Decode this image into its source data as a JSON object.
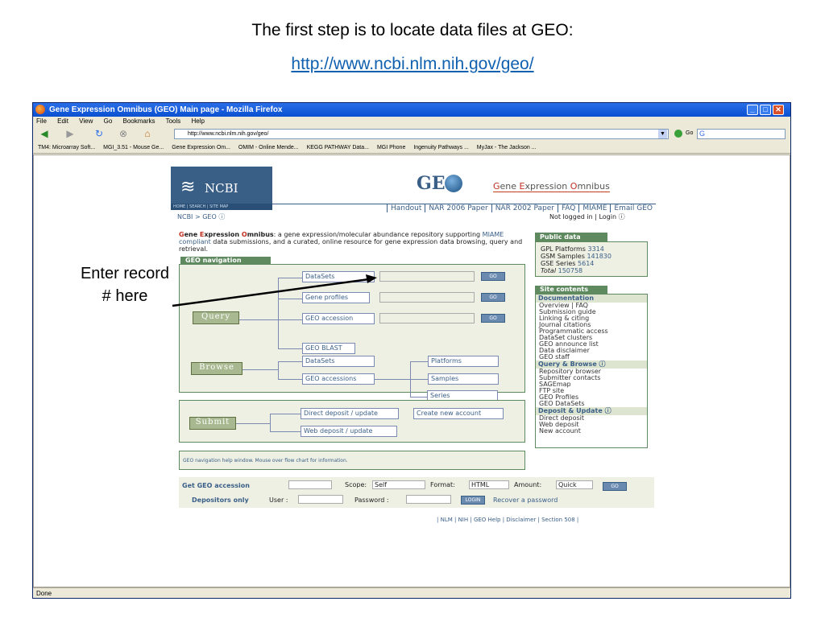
{
  "slide": {
    "title": "The first step is to locate data files at GEO:",
    "url": "http://www.ncbi.nlm.nih.gov/geo/",
    "annotation": "Enter record # here"
  },
  "browser": {
    "title": "Gene Expression Omnibus (GEO) Main page - Mozilla Firefox",
    "menu": [
      "File",
      "Edit",
      "View",
      "Go",
      "Bookmarks",
      "Tools",
      "Help"
    ],
    "address": "http://www.ncbi.nlm.nih.gov/geo/",
    "go_label": "Go",
    "bookmarks": [
      "TM4: Microarray Soft...",
      "MGI_3.51 - Mouse Ge...",
      "Gene Expression Om...",
      "OMIM - Online Mende...",
      "KEGG PATHWAY Data...",
      "MGI Phone",
      "Ingenuity Pathways ...",
      "MyJax - The Jackson ..."
    ],
    "status": "Done"
  },
  "geo": {
    "ncbi": "NCBI",
    "home_links": "HOME | SEARCH | SITE MAP",
    "geo_logo": "GE",
    "subtitle_parts": [
      "G",
      "ene ",
      "E",
      "xpression ",
      "O",
      "mnibus"
    ],
    "nav_links": [
      "Handout",
      "NAR 2006 Paper",
      "NAR 2002 Paper",
      "FAQ",
      "MIAME",
      "Email GEO"
    ],
    "breadcrumb": "NCBI > GEO",
    "login_status": "Not logged in | Login",
    "intro_bold": [
      "G",
      "ene ",
      "E",
      "xpression ",
      "O",
      "mnibus"
    ],
    "intro_rest": ": a gene expression/molecular abundance repository supporting",
    "intro_link": "MIAME compliant",
    "intro_end": "data submissions, and a curated, online resource for gene expression data browsing, query and retrieval.",
    "nav_tab": "GEO navigation",
    "query": "Query",
    "browse": "Browse",
    "submit": "Submit",
    "query_items": [
      "DataSets",
      "Gene profiles",
      "GEO accession",
      "GEO BLAST"
    ],
    "browse_items": [
      "DataSets",
      "GEO accessions"
    ],
    "browse_sub": [
      "Platforms",
      "Samples",
      "Series"
    ],
    "submit_items": [
      "Direct deposit / update",
      "Web deposit / update",
      "Create new account"
    ],
    "go": "GO",
    "help": "GEO navigation help window. Mouse over flow chart for information.",
    "get_accession": "Get GEO accession",
    "scope_label": "Scope:",
    "scope_value": "Self",
    "format_label": "Format:",
    "format_value": "HTML",
    "amount_label": "Amount:",
    "amount_value": "Quick",
    "depositors": "Depositors only",
    "user_label": "User :",
    "password_label": "Password :",
    "login_btn": "LOGIN",
    "recover": "Recover a password",
    "footer": "| NLM | NIH | GEO Help | Disclaimer | Section 508 |",
    "public_data_title": "Public data",
    "public_data": [
      {
        "k": "GPL  Platforms",
        "v": "3314"
      },
      {
        "k": "GSM  Samples",
        "v": "141830"
      },
      {
        "k": "GSE  Series",
        "v": "5614"
      },
      {
        "k": "Total",
        "v": "150758"
      }
    ],
    "site_contents": "Site contents",
    "documentation": "Documentation",
    "doc_items": [
      "Overview  |  FAQ",
      "Submission guide",
      "Linking & citing",
      "Journal citations",
      "Programmatic access",
      "DataSet clusters",
      "GEO announce list",
      "Data disclaimer",
      "GEO staff"
    ],
    "query_browse": "Query & Browse",
    "qb_items": [
      "Repository browser",
      "Submitter contacts",
      "SAGEmap",
      "FTP site",
      "GEO Profiles",
      "GEO DataSets"
    ],
    "deposit": "Deposit & Update",
    "dep_items": [
      "Direct deposit",
      "Web deposit",
      "New account"
    ]
  }
}
